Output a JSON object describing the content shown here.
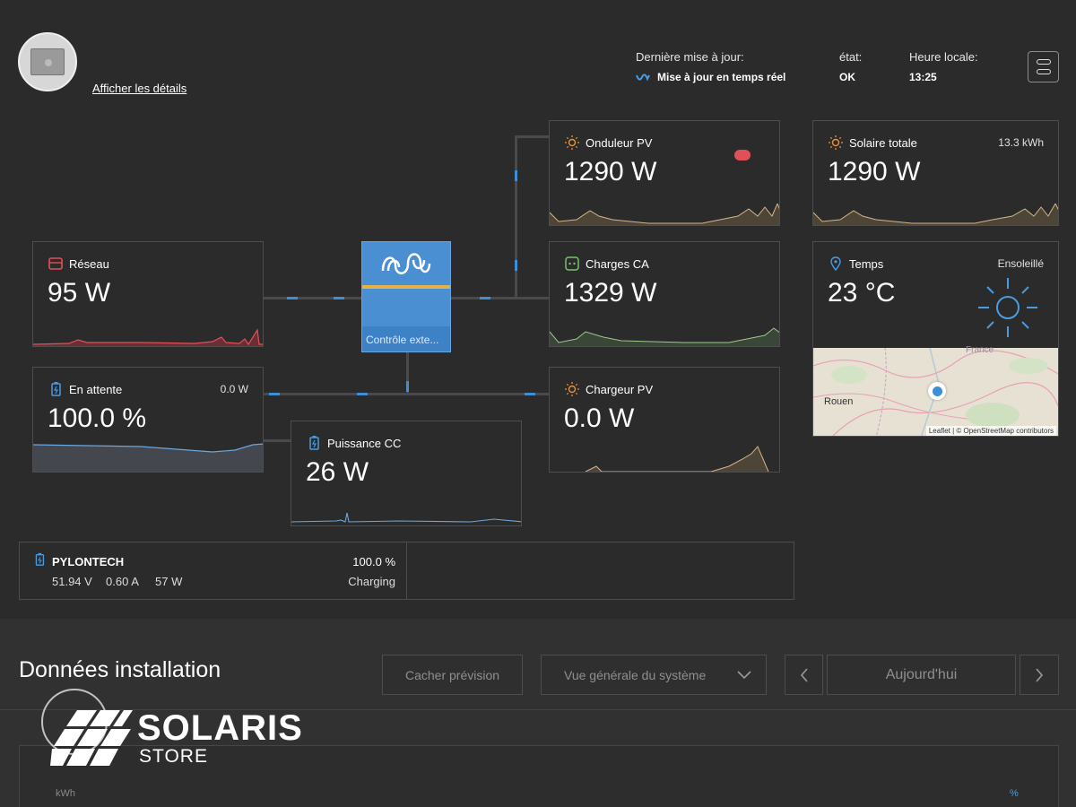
{
  "header": {
    "details_link": "Afficher les détails",
    "last_update_label": "Dernière mise à jour:",
    "last_update_value": "Mise à jour en temps réel",
    "state_label": "état:",
    "state_value": "OK",
    "local_time_label": "Heure locale:",
    "local_time_value": "13:25"
  },
  "cards": {
    "grid": {
      "title": "Réseau",
      "value": "95 W"
    },
    "standby": {
      "title": "En attente",
      "value": "100.0 %",
      "extra": "0.0 W"
    },
    "dc_power": {
      "title": "Puissance CC",
      "value": "26 W"
    },
    "pv_inverter": {
      "title": "Onduleur PV",
      "value": "1290 W"
    },
    "ac_loads": {
      "title": "Charges CA",
      "value": "1329 W"
    },
    "pv_charger": {
      "title": "Chargeur PV",
      "value": "0.0 W"
    },
    "total_solar": {
      "title": "Solaire totale",
      "value": "1290 W",
      "extra": "13.3 kWh"
    },
    "weather": {
      "title": "Temps",
      "value": "23 °C",
      "extra": "Ensoleillé",
      "map_city": "Rouen",
      "map_region": "France",
      "map_attribution": "Leaflet | © OpenStreetMap contributors"
    }
  },
  "inverter": {
    "label": "Contrôle exte..."
  },
  "battery": {
    "name": "PYLONTECH",
    "voltage": "51.94 V",
    "current": "0.60 A",
    "power": "57 W",
    "soc": "100.0 %",
    "state": "Charging"
  },
  "installation": {
    "title": "Données installation",
    "hide_forecast": "Cacher prévision",
    "view_select": "Vue générale du système",
    "today": "Aujourd'hui",
    "y_left_unit": "kWh",
    "y_right_unit": "%"
  },
  "watermark": {
    "brand": "SOLARIS",
    "sub": "STORE"
  },
  "colors": {
    "background": "#2b2b2c",
    "accent_blue": "#3f8fd6",
    "grid_red": "#e0505a",
    "solar_orange": "#e8913a",
    "ac_green": "#7ac26a"
  }
}
